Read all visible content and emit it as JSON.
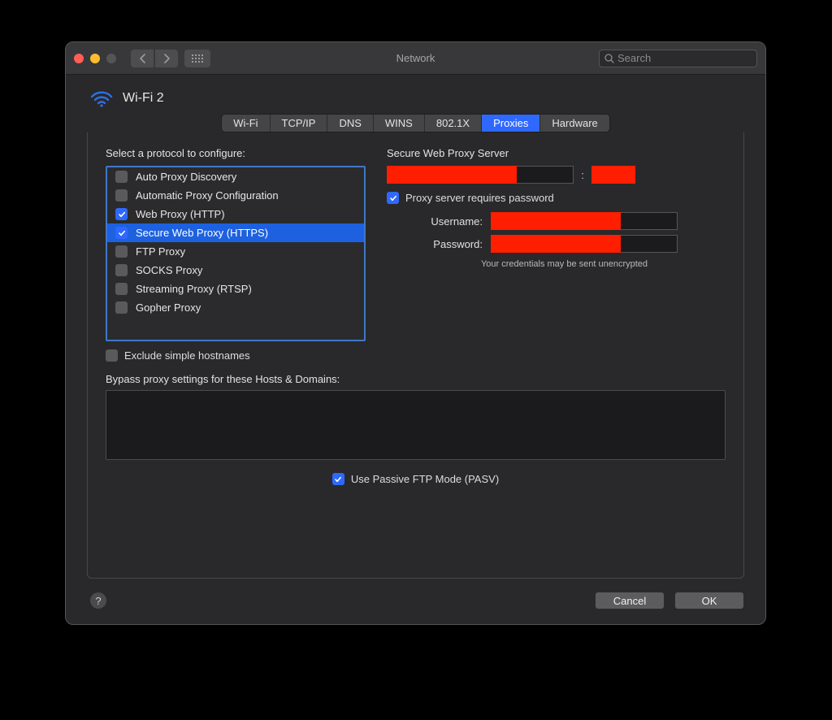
{
  "window": {
    "title": "Network"
  },
  "search": {
    "placeholder": "Search",
    "value": ""
  },
  "interface": {
    "name": "Wi-Fi 2"
  },
  "tabs": [
    {
      "label": "Wi-Fi",
      "active": false
    },
    {
      "label": "TCP/IP",
      "active": false
    },
    {
      "label": "DNS",
      "active": false
    },
    {
      "label": "WINS",
      "active": false
    },
    {
      "label": "802.1X",
      "active": false
    },
    {
      "label": "Proxies",
      "active": true
    },
    {
      "label": "Hardware",
      "active": false
    }
  ],
  "left": {
    "heading": "Select a protocol to configure:",
    "protocols": [
      {
        "label": "Auto Proxy Discovery",
        "checked": false,
        "selected": false
      },
      {
        "label": "Automatic Proxy Configuration",
        "checked": false,
        "selected": false
      },
      {
        "label": "Web Proxy (HTTP)",
        "checked": true,
        "selected": false
      },
      {
        "label": "Secure Web Proxy (HTTPS)",
        "checked": true,
        "selected": true
      },
      {
        "label": "FTP Proxy",
        "checked": false,
        "selected": false
      },
      {
        "label": "SOCKS Proxy",
        "checked": false,
        "selected": false
      },
      {
        "label": "Streaming Proxy (RTSP)",
        "checked": false,
        "selected": false
      },
      {
        "label": "Gopher Proxy",
        "checked": false,
        "selected": false
      }
    ],
    "exclude_simple": {
      "label": "Exclude simple hostnames",
      "checked": false
    }
  },
  "right": {
    "heading": "Secure Web Proxy Server",
    "server": {
      "host_redacted": true,
      "port_redacted": true,
      "separator": ":"
    },
    "auth": {
      "requires_label": "Proxy server requires password",
      "requires_checked": true,
      "username_label": "Username:",
      "password_label": "Password:",
      "username_redacted": true,
      "password_redacted": true,
      "note": "Your credentials may be sent unencrypted"
    }
  },
  "bypass": {
    "label": "Bypass proxy settings for these Hosts & Domains:",
    "value": ""
  },
  "pasv": {
    "label": "Use Passive FTP Mode (PASV)",
    "checked": true
  },
  "buttons": {
    "cancel": "Cancel",
    "ok": "OK"
  }
}
